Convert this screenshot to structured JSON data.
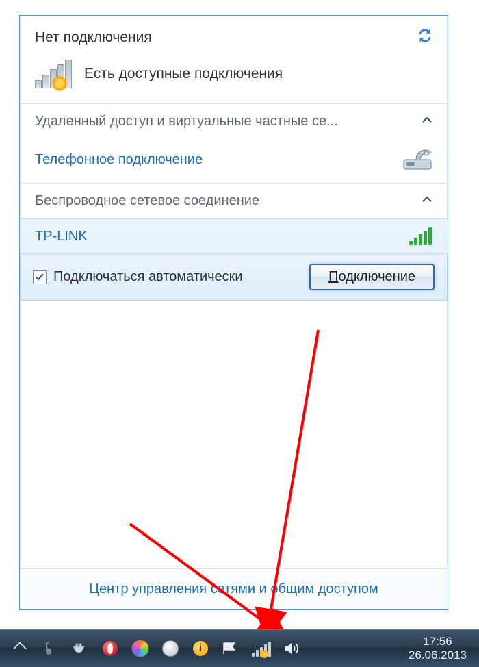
{
  "header": {
    "title": "Нет подключения"
  },
  "status_line": "Есть доступные подключения",
  "sections": {
    "vpn_title": "Удаленный доступ и виртуальные частные се...",
    "dialup_label": "Телефонное подключение",
    "wifi_title": "Беспроводное сетевое соединение"
  },
  "wifi": {
    "ssid": "TP-LINK",
    "auto_label": "Подключаться автоматически",
    "auto_checked": true,
    "connect_btn": "Подключение",
    "connect_btn_prefix": "П",
    "connect_btn_rest": "одключение"
  },
  "footer_link": "Центр управления сетями и общим доступом",
  "taskbar": {
    "time": "17:56",
    "date": "26.06.2013"
  }
}
